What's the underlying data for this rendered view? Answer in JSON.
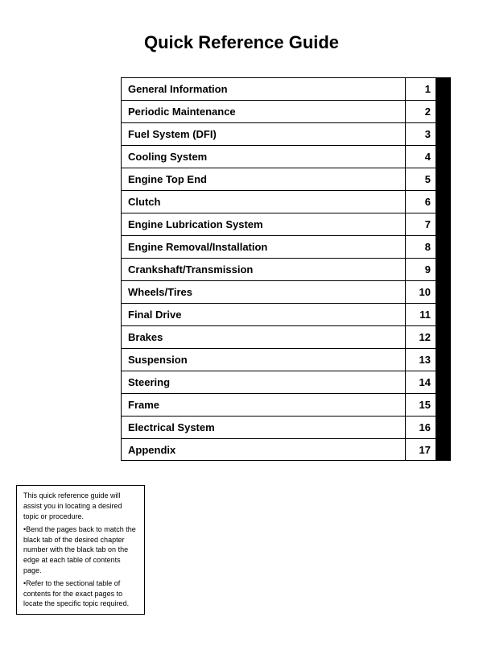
{
  "page": {
    "title": "Quick Reference Guide"
  },
  "toc": {
    "items": [
      {
        "label": "General Information",
        "number": "1"
      },
      {
        "label": "Periodic Maintenance",
        "number": "2"
      },
      {
        "label": "Fuel System (DFI)",
        "number": "3"
      },
      {
        "label": "Cooling System",
        "number": "4"
      },
      {
        "label": "Engine Top End",
        "number": "5"
      },
      {
        "label": "Clutch",
        "number": "6"
      },
      {
        "label": "Engine Lubrication System",
        "number": "7"
      },
      {
        "label": "Engine Removal/Installation",
        "number": "8"
      },
      {
        "label": "Crankshaft/Transmission",
        "number": "9"
      },
      {
        "label": "Wheels/Tires",
        "number": "10"
      },
      {
        "label": "Final Drive",
        "number": "11"
      },
      {
        "label": "Brakes",
        "number": "12"
      },
      {
        "label": "Suspension",
        "number": "13"
      },
      {
        "label": "Steering",
        "number": "14"
      },
      {
        "label": "Frame",
        "number": "15"
      },
      {
        "label": "Electrical System",
        "number": "16"
      },
      {
        "label": "Appendix",
        "number": "17"
      }
    ]
  },
  "note": {
    "line1": "This quick reference guide will assist you in locating a desired topic or procedure.",
    "line2": "•Bend the pages back to match the black tab of the desired chapter number with the black tab on the edge at each table of contents page.",
    "line3": "•Refer to the sectional table of contents for the exact pages to locate the specific topic required."
  }
}
